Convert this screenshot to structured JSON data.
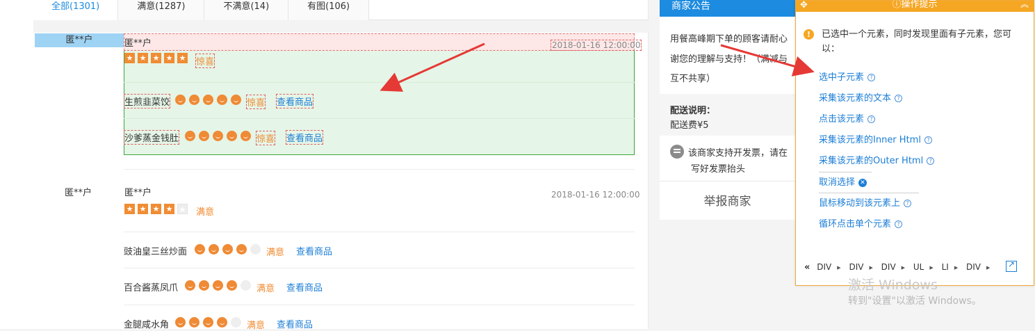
{
  "tabs": [
    {
      "label": "全部(1301)",
      "active": true
    },
    {
      "label": "满意(1287)",
      "active": false
    },
    {
      "label": "不满意(14)",
      "active": false
    },
    {
      "label": "有图(106)",
      "active": false
    }
  ],
  "reviews": [
    {
      "user": "匿**户",
      "name": "匿**户",
      "date": "2018-01-16 12:00:00",
      "stars": 5,
      "tag": "惊喜",
      "items": [
        {
          "name": "生煎韭菜饺",
          "score": 5,
          "tag": "惊喜",
          "link": "查看商品"
        },
        {
          "name": "沙爹蒸金钱肚",
          "score": 5,
          "tag": "惊喜",
          "link": "查看商品"
        }
      ]
    },
    {
      "user": "匿**户",
      "name": "匿**户",
      "date": "2018-01-16 12:00:00",
      "stars": 4,
      "tag": "满意",
      "items": [
        {
          "name": "豉油皇三丝炒面",
          "score": 4,
          "tag": "满意",
          "link": "查看商品"
        },
        {
          "name": "百合酱蒸凤爪",
          "score": 4,
          "tag": "满意",
          "link": "查看商品"
        },
        {
          "name": "金腿咸水角",
          "score": 4,
          "tag": "满意",
          "link": "查看商品"
        }
      ]
    }
  ],
  "sidebar": {
    "title": "商家公告",
    "notice_lines": [
      "用餐高峰期下单的顾客请耐心",
      "谢您的理解与支持！（满减与",
      "互不共享）"
    ],
    "delivery_label": "配送说明：",
    "delivery_fee": "配送费¥5",
    "invoice_lines": [
      "该商家支持开发票，请在",
      "写好发票抬头"
    ],
    "report": "举报商家"
  },
  "panel": {
    "title": "操作提示",
    "message": "已选中一个元素，同时发现里面有子元素，您可以：",
    "options": [
      "选中子元素",
      "采集该元素的文本",
      "点击该元素",
      "采集该元素的Inner Html",
      "采集该元素的Outer Html",
      "取消选择",
      "鼠标移动到该元素上",
      "循环点击单个元素"
    ],
    "breadcrumb": [
      "DIV",
      "DIV",
      "DIV",
      "UL",
      "LI",
      "DIV"
    ]
  },
  "watermark": {
    "line1": "激活 Windows",
    "line2": "转到\"设置\"以激活 Windows。"
  },
  "colors": {
    "accent": "#1c8be0",
    "star": "#f08c33",
    "panel": "#f5a623",
    "highlight_border": "#3aa63a",
    "arrow": "#e53935"
  }
}
